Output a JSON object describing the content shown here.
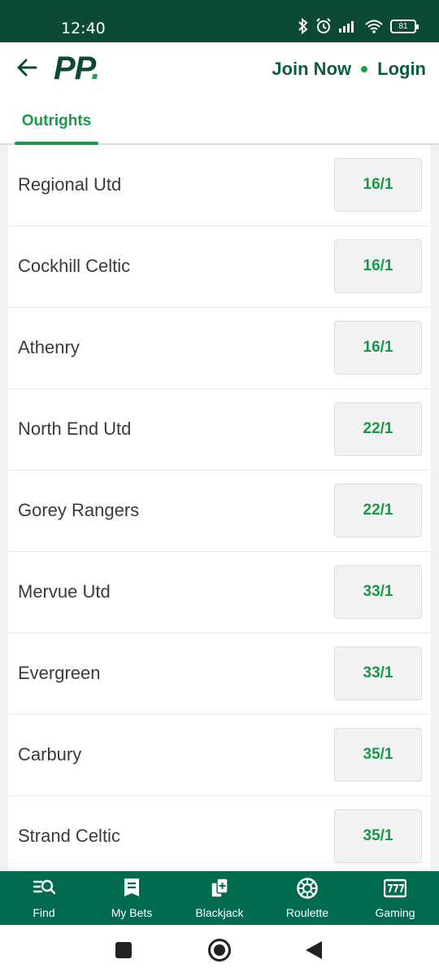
{
  "status": {
    "time": "12:40",
    "battery": "81"
  },
  "header": {
    "join_label": "Join Now",
    "login_label": "Login",
    "logo_text": "PP",
    "logo_dot": "."
  },
  "tabs": [
    {
      "label": "Outrights"
    }
  ],
  "outrights": [
    {
      "team": "Regional Utd",
      "odds": "16/1"
    },
    {
      "team": "Cockhill Celtic",
      "odds": "16/1"
    },
    {
      "team": "Athenry",
      "odds": "16/1"
    },
    {
      "team": "North End Utd",
      "odds": "22/1"
    },
    {
      "team": "Gorey Rangers",
      "odds": "22/1"
    },
    {
      "team": "Mervue Utd",
      "odds": "33/1"
    },
    {
      "team": "Evergreen",
      "odds": "33/1"
    },
    {
      "team": "Carbury",
      "odds": "35/1"
    },
    {
      "team": "Strand Celtic",
      "odds": "35/1"
    }
  ],
  "bottom_nav": [
    {
      "label": "Find",
      "icon": "search-list-icon"
    },
    {
      "label": "My Bets",
      "icon": "bet-slip-icon"
    },
    {
      "label": "Blackjack",
      "icon": "cards-icon"
    },
    {
      "label": "Roulette",
      "icon": "roulette-icon"
    },
    {
      "label": "Gaming",
      "icon": "slot-machine-icon"
    }
  ],
  "colors": {
    "brand_dark": "#0c4a33",
    "accent_green": "#179a45",
    "nav_green": "#006b4f"
  }
}
